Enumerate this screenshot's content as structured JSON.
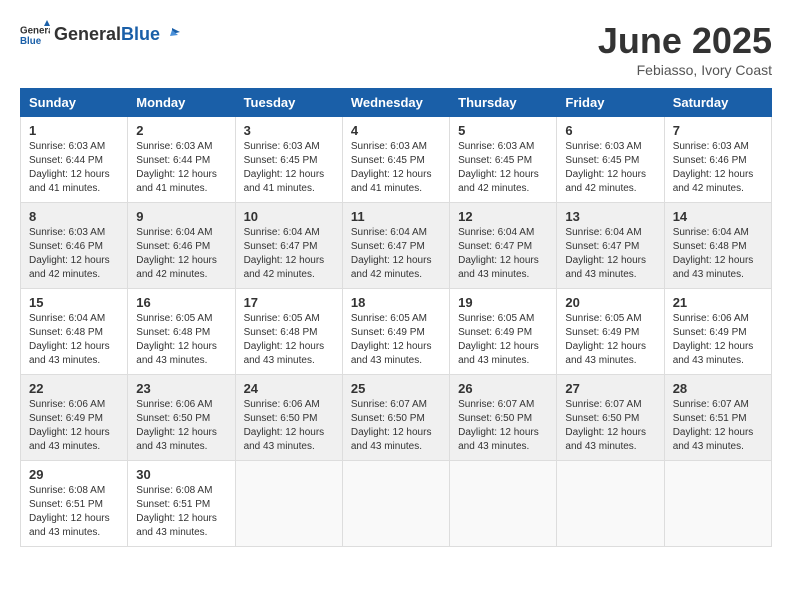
{
  "header": {
    "logo_general": "General",
    "logo_blue": "Blue",
    "title": "June 2025",
    "subtitle": "Febiasso, Ivory Coast"
  },
  "calendar": {
    "days_of_week": [
      "Sunday",
      "Monday",
      "Tuesday",
      "Wednesday",
      "Thursday",
      "Friday",
      "Saturday"
    ],
    "weeks": [
      [
        {
          "day": "1",
          "sunrise": "6:03 AM",
          "sunset": "6:44 PM",
          "daylight": "12 hours and 41 minutes."
        },
        {
          "day": "2",
          "sunrise": "6:03 AM",
          "sunset": "6:44 PM",
          "daylight": "12 hours and 41 minutes."
        },
        {
          "day": "3",
          "sunrise": "6:03 AM",
          "sunset": "6:45 PM",
          "daylight": "12 hours and 41 minutes."
        },
        {
          "day": "4",
          "sunrise": "6:03 AM",
          "sunset": "6:45 PM",
          "daylight": "12 hours and 41 minutes."
        },
        {
          "day": "5",
          "sunrise": "6:03 AM",
          "sunset": "6:45 PM",
          "daylight": "12 hours and 42 minutes."
        },
        {
          "day": "6",
          "sunrise": "6:03 AM",
          "sunset": "6:45 PM",
          "daylight": "12 hours and 42 minutes."
        },
        {
          "day": "7",
          "sunrise": "6:03 AM",
          "sunset": "6:46 PM",
          "daylight": "12 hours and 42 minutes."
        }
      ],
      [
        {
          "day": "8",
          "sunrise": "6:03 AM",
          "sunset": "6:46 PM",
          "daylight": "12 hours and 42 minutes."
        },
        {
          "day": "9",
          "sunrise": "6:04 AM",
          "sunset": "6:46 PM",
          "daylight": "12 hours and 42 minutes."
        },
        {
          "day": "10",
          "sunrise": "6:04 AM",
          "sunset": "6:47 PM",
          "daylight": "12 hours and 42 minutes."
        },
        {
          "day": "11",
          "sunrise": "6:04 AM",
          "sunset": "6:47 PM",
          "daylight": "12 hours and 42 minutes."
        },
        {
          "day": "12",
          "sunrise": "6:04 AM",
          "sunset": "6:47 PM",
          "daylight": "12 hours and 43 minutes."
        },
        {
          "day": "13",
          "sunrise": "6:04 AM",
          "sunset": "6:47 PM",
          "daylight": "12 hours and 43 minutes."
        },
        {
          "day": "14",
          "sunrise": "6:04 AM",
          "sunset": "6:48 PM",
          "daylight": "12 hours and 43 minutes."
        }
      ],
      [
        {
          "day": "15",
          "sunrise": "6:04 AM",
          "sunset": "6:48 PM",
          "daylight": "12 hours and 43 minutes."
        },
        {
          "day": "16",
          "sunrise": "6:05 AM",
          "sunset": "6:48 PM",
          "daylight": "12 hours and 43 minutes."
        },
        {
          "day": "17",
          "sunrise": "6:05 AM",
          "sunset": "6:48 PM",
          "daylight": "12 hours and 43 minutes."
        },
        {
          "day": "18",
          "sunrise": "6:05 AM",
          "sunset": "6:49 PM",
          "daylight": "12 hours and 43 minutes."
        },
        {
          "day": "19",
          "sunrise": "6:05 AM",
          "sunset": "6:49 PM",
          "daylight": "12 hours and 43 minutes."
        },
        {
          "day": "20",
          "sunrise": "6:05 AM",
          "sunset": "6:49 PM",
          "daylight": "12 hours and 43 minutes."
        },
        {
          "day": "21",
          "sunrise": "6:06 AM",
          "sunset": "6:49 PM",
          "daylight": "12 hours and 43 minutes."
        }
      ],
      [
        {
          "day": "22",
          "sunrise": "6:06 AM",
          "sunset": "6:49 PM",
          "daylight": "12 hours and 43 minutes."
        },
        {
          "day": "23",
          "sunrise": "6:06 AM",
          "sunset": "6:50 PM",
          "daylight": "12 hours and 43 minutes."
        },
        {
          "day": "24",
          "sunrise": "6:06 AM",
          "sunset": "6:50 PM",
          "daylight": "12 hours and 43 minutes."
        },
        {
          "day": "25",
          "sunrise": "6:07 AM",
          "sunset": "6:50 PM",
          "daylight": "12 hours and 43 minutes."
        },
        {
          "day": "26",
          "sunrise": "6:07 AM",
          "sunset": "6:50 PM",
          "daylight": "12 hours and 43 minutes."
        },
        {
          "day": "27",
          "sunrise": "6:07 AM",
          "sunset": "6:50 PM",
          "daylight": "12 hours and 43 minutes."
        },
        {
          "day": "28",
          "sunrise": "6:07 AM",
          "sunset": "6:51 PM",
          "daylight": "12 hours and 43 minutes."
        }
      ],
      [
        {
          "day": "29",
          "sunrise": "6:08 AM",
          "sunset": "6:51 PM",
          "daylight": "12 hours and 43 minutes."
        },
        {
          "day": "30",
          "sunrise": "6:08 AM",
          "sunset": "6:51 PM",
          "daylight": "12 hours and 43 minutes."
        },
        null,
        null,
        null,
        null,
        null
      ]
    ],
    "labels": {
      "sunrise": "Sunrise: ",
      "sunset": "Sunset: ",
      "daylight": "Daylight: "
    }
  }
}
